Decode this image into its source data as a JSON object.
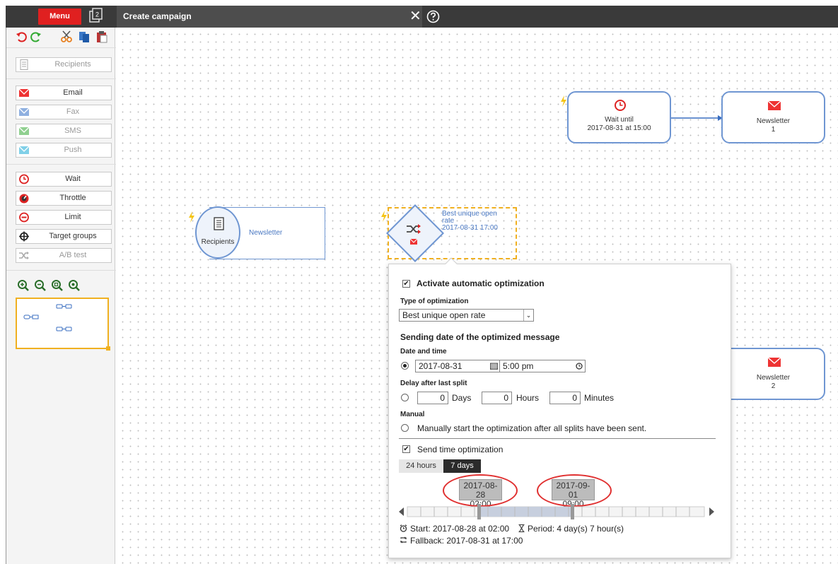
{
  "topbar": {
    "menu_label": "Menu",
    "window_count": "2",
    "title": "Create campaign"
  },
  "sidebar": {
    "tools": [
      "undo-icon",
      "redo-icon",
      "cut-icon",
      "copy-icon",
      "paste-icon"
    ],
    "recipients_label": "Recipients",
    "channels": [
      {
        "label": "Email",
        "enabled": true
      },
      {
        "label": "Fax",
        "enabled": false
      },
      {
        "label": "SMS",
        "enabled": false
      },
      {
        "label": "Push",
        "enabled": false
      }
    ],
    "logic": [
      {
        "label": "Wait",
        "enabled": true
      },
      {
        "label": "Throttle",
        "enabled": true
      },
      {
        "label": "Limit",
        "enabled": true
      },
      {
        "label": "Target groups",
        "enabled": true
      },
      {
        "label": "A/B test",
        "enabled": false
      }
    ],
    "zoom_tools": [
      "zoom-in-icon",
      "zoom-out-icon",
      "zoom-fit-icon",
      "zoom-reset-icon"
    ]
  },
  "canvas": {
    "recipients_node": {
      "label": "Recipients",
      "name": "Newsletter"
    },
    "ab_node": {
      "line1": "Best unique open",
      "line2": "rate",
      "line3": "2017-08-31 17:00"
    },
    "wait_node": {
      "line1": "Wait until",
      "line2": "2017-08-31 at 15:00"
    },
    "newsletter1": {
      "line1": "Newsletter",
      "line2": "1"
    },
    "newsletter2": {
      "line1": "Newsletter",
      "line2": "2"
    }
  },
  "popup": {
    "activate_label": "Activate automatic optimization",
    "activate_checked": true,
    "type_label": "Type of optimization",
    "type_value": "Best unique open rate",
    "sending_heading": "Sending date of the optimized message",
    "date_time_label": "Date and time",
    "date_value": "2017-08-31",
    "time_value": "5:00 pm",
    "delay_label": "Delay after last split",
    "days_value": "0",
    "days_label": "Days",
    "hours_value": "0",
    "hours_label": "Hours",
    "minutes_value": "0",
    "minutes_label": "Minutes",
    "manual_label": "Manual",
    "manual_text": "Manually start the optimization after all splits have been sent.",
    "sto_label": "Send time optimization",
    "sto_checked": true,
    "tab_24h": "24 hours",
    "tab_7d": "7 days",
    "tip_start_date": "2017-08-28",
    "tip_start_time": "02:00",
    "tip_end_date": "2017-09-01",
    "tip_end_time": "09:00",
    "start_text": "Start: 2017-08-28 at 02:00",
    "period_text": "Period: 4 day(s) 7 hour(s)",
    "fallback_text": "Fallback: 2017-08-31 at 17:00"
  },
  "colors": {
    "menu_red": "#e02020",
    "node_border": "#6f96d2",
    "highlight_red": "#e03030",
    "selection_orange": "#f0b020"
  }
}
